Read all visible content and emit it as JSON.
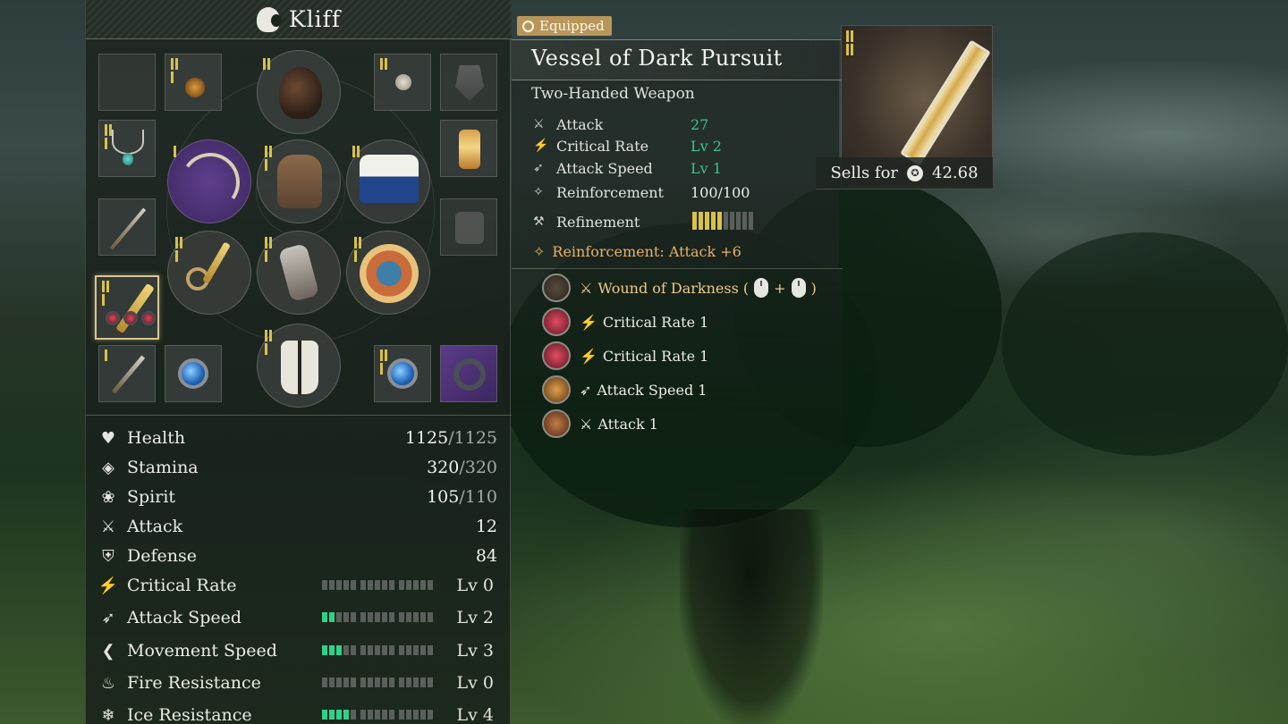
{
  "character": {
    "name": "Kliff"
  },
  "equipped_badge": "Equipped",
  "item": {
    "name": "Vessel of Dark Pursuit",
    "type": "Two-Handed Weapon",
    "attributes": [
      {
        "label": "Attack",
        "value": "27",
        "icon": "sword-icon"
      },
      {
        "label": "Critical Rate",
        "value": "Lv 2",
        "icon": "critical-icon"
      },
      {
        "label": "Attack Speed",
        "value": "Lv 1",
        "icon": "speed-icon"
      },
      {
        "label": "Reinforcement",
        "value": "100/100",
        "icon": "reinforce-icon"
      },
      {
        "label": "Refinement",
        "value": "",
        "icon": "refine-icon"
      }
    ],
    "refinement_level": 5,
    "refinement_max": 10,
    "reinforcement_bonus": "Reinforcement: Attack +6",
    "sells_label": "Sells for",
    "sells_value": "42.68"
  },
  "skills": [
    {
      "text": "Wound of Darkness (",
      "suffix": ")",
      "gold": true,
      "gem": "dark"
    },
    {
      "text": "Critical Rate 1",
      "gold": false,
      "gem": "red"
    },
    {
      "text": "Critical Rate 1",
      "gold": false,
      "gem": "red"
    },
    {
      "text": "Attack Speed 1",
      "gold": false,
      "gem": "amber"
    },
    {
      "text": "Attack 1",
      "gold": false,
      "gem": "brown"
    }
  ],
  "stats": [
    {
      "label": "Health",
      "value": "1125",
      "max": "/1125",
      "icon": "heart-icon"
    },
    {
      "label": "Stamina",
      "value": "320",
      "max": "/320",
      "icon": "stamina-icon"
    },
    {
      "label": "Spirit",
      "value": "105",
      "max": "/110",
      "icon": "spirit-icon"
    },
    {
      "label": "Attack",
      "value": "12",
      "max": "",
      "icon": "sword-icon"
    },
    {
      "label": "Defense",
      "value": "84",
      "max": "",
      "icon": "shield-icon"
    }
  ],
  "level_stats": [
    {
      "label": "Critical Rate",
      "level": "Lv 0",
      "filled": 0,
      "icon": "critical-icon"
    },
    {
      "label": "Attack Speed",
      "level": "Lv 2",
      "filled": 2,
      "icon": "speed-icon"
    },
    {
      "label": "Movement Speed",
      "level": "Lv 3",
      "filled": 3,
      "icon": "boot-icon"
    },
    {
      "label": "Fire Resistance",
      "level": "Lv 0",
      "filled": 0,
      "icon": "fire-icon"
    },
    {
      "label": "Ice Resistance",
      "level": "Lv 4",
      "filled": 4,
      "icon": "snowflake-icon"
    }
  ],
  "colors": {
    "accent_gold": "#d9c14a",
    "bar_green": "#2fd18a",
    "skill_gold": "#f0c98a",
    "badge": "#b8965a"
  }
}
